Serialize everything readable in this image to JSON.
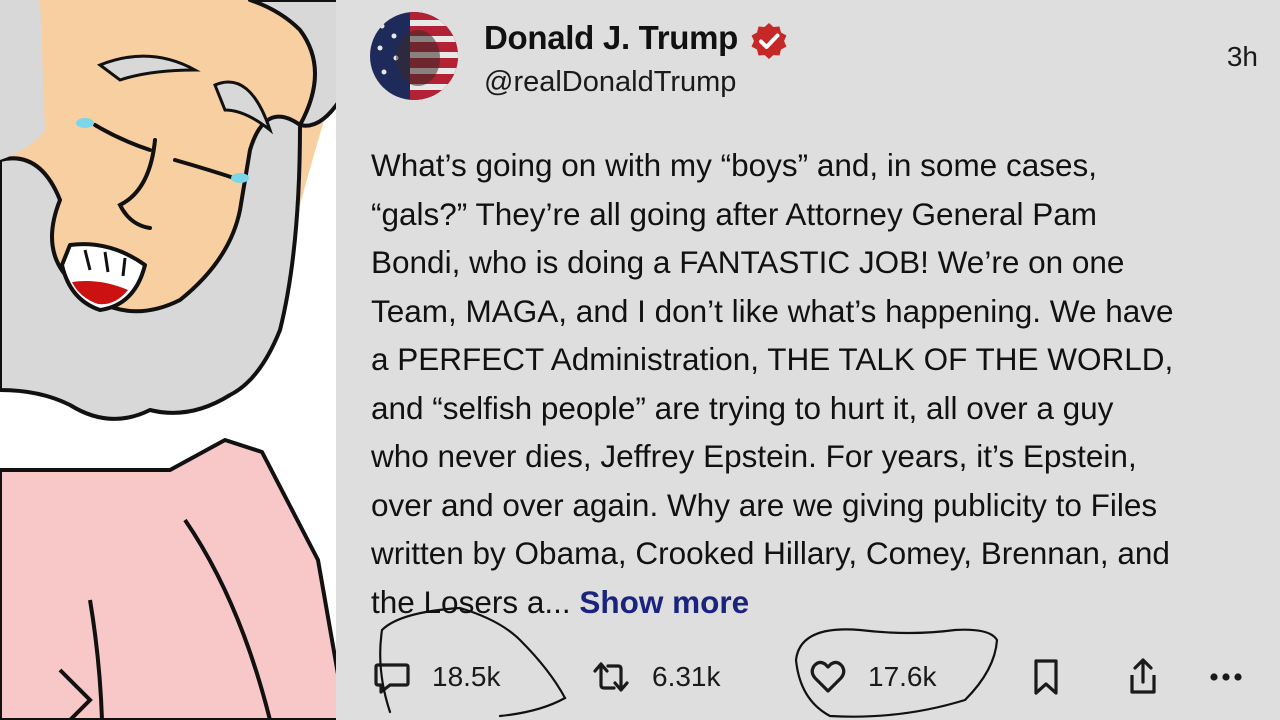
{
  "post": {
    "author_name": "Donald J. Trump",
    "handle": "@realDonaldTrump",
    "time": "3h",
    "text": "What’s going on with my “boys” and, in some cases,\n“gals?” They’re all going after Attorney General Pam\nBondi, who is doing a FANTASTIC JOB! We’re on one\nTeam, MAGA, and I don’t like what’s happening. We have\na PERFECT Administration, THE TALK OF THE WORLD,\nand “selfish people” are trying to hurt it, all over a guy\nwho never dies, Jeffrey Epstein. For years, it’s Epstein,\nover and over again. Why are we giving publicity to Files\nwritten by Obama, Crooked Hillary, Comey, Brennan, and\nthe Losers a... ",
    "show_more_label": "Show more"
  },
  "actions": {
    "reply_count": "18.5k",
    "repost_count": "6.31k",
    "like_count": "17.6k"
  },
  "icons": {
    "verified": "verified-badge-icon",
    "reply": "reply-icon",
    "repost": "repost-icon",
    "like": "heart-icon",
    "bookmark": "bookmark-icon",
    "share": "share-icon",
    "more": "more-icon"
  },
  "colors": {
    "post_background": "#dedede",
    "verified_badge": "#c62828",
    "show_more": "#1a237e",
    "cartoon_skin": "#f8cfa0",
    "cartoon_beard": "#d8d8d8",
    "cartoon_shirt": "#f8c8c8",
    "ink": "#111111"
  }
}
